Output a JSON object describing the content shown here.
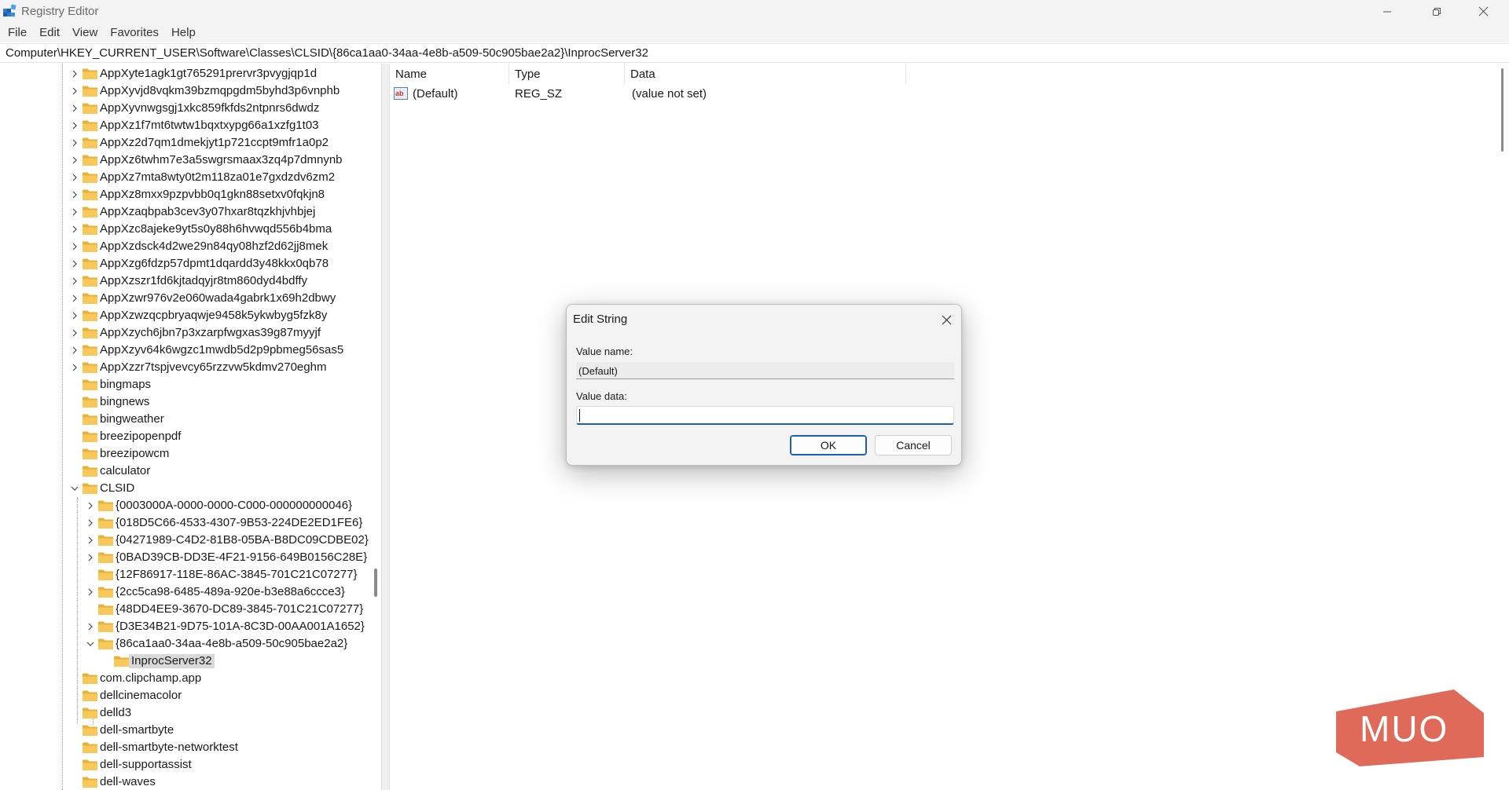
{
  "window": {
    "title": "Registry Editor",
    "colors": {
      "titlebar": "#f3f3f3",
      "accent": "#1a5fb4",
      "folder": "#f8c95a",
      "selection": "#d9d9d9"
    }
  },
  "menu": [
    "File",
    "Edit",
    "View",
    "Favorites",
    "Help"
  ],
  "address": "Computer\\HKEY_CURRENT_USER\\Software\\Classes\\CLSID\\{86ca1aa0-34aa-4e8b-a509-50c905bae2a2}\\InprocServer32",
  "tree": [
    {
      "label": "AppXyte1agk1gt765291prervr3pvygjqp1d",
      "level": 0,
      "chevron": "right"
    },
    {
      "label": "AppXyvjd8vqkm39bzmqpgdm5byhd3p6vnphb",
      "level": 0,
      "chevron": "right"
    },
    {
      "label": "AppXyvnwgsgj1xkc859fkfds2ntpnrs6dwdz",
      "level": 0,
      "chevron": "right"
    },
    {
      "label": "AppXz1f7mt6twtw1bqxtxypg66a1xzfg1t03",
      "level": 0,
      "chevron": "right"
    },
    {
      "label": "AppXz2d7qm1dmekjyt1p721ccpt9mfr1a0p2",
      "level": 0,
      "chevron": "right"
    },
    {
      "label": "AppXz6twhm7e3a5swgrsmaax3zq4p7dmnynb",
      "level": 0,
      "chevron": "right"
    },
    {
      "label": "AppXz7mta8wty0t2m118za01e7gxdzdv6zm2",
      "level": 0,
      "chevron": "right"
    },
    {
      "label": "AppXz8mxx9pzpvbb0q1gkn88setxv0fqkjn8",
      "level": 0,
      "chevron": "right"
    },
    {
      "label": "AppXzaqbpab3cev3y07hxar8tqzkhjvhbjej",
      "level": 0,
      "chevron": "right"
    },
    {
      "label": "AppXzc8ajeke9yt5s0y88h6hvwqd556b4bma",
      "level": 0,
      "chevron": "right"
    },
    {
      "label": "AppXzdsck4d2we29n84qy08hzf2d62jj8mek",
      "level": 0,
      "chevron": "right"
    },
    {
      "label": "AppXzg6fdzp57dpmt1dqardd3y48kkx0qb78",
      "level": 0,
      "chevron": "right"
    },
    {
      "label": "AppXzszr1fd6kjtadqyjr8tm860dyd4bdffy",
      "level": 0,
      "chevron": "right"
    },
    {
      "label": "AppXzwr976v2e060wada4gabrk1x69h2dbwy",
      "level": 0,
      "chevron": "right"
    },
    {
      "label": "AppXzwzqcpbryaqwje9458k5ykwbyg5fzk8y",
      "level": 0,
      "chevron": "right"
    },
    {
      "label": "AppXzych6jbn7p3xzarpfwgxas39g87myyjf",
      "level": 0,
      "chevron": "right"
    },
    {
      "label": "AppXzyv64k6wgzc1mwdb5d2p9pbmeg56sas5",
      "level": 0,
      "chevron": "right"
    },
    {
      "label": "AppXzzr7tspjvevcy65rzzvw5kdmv270eghm",
      "level": 0,
      "chevron": "right"
    },
    {
      "label": "bingmaps",
      "level": 0,
      "chevron": "none"
    },
    {
      "label": "bingnews",
      "level": 0,
      "chevron": "none"
    },
    {
      "label": "bingweather",
      "level": 0,
      "chevron": "none"
    },
    {
      "label": "breezipopenpdf",
      "level": 0,
      "chevron": "none"
    },
    {
      "label": "breezipowcm",
      "level": 0,
      "chevron": "none"
    },
    {
      "label": "calculator",
      "level": 0,
      "chevron": "none"
    },
    {
      "label": "CLSID",
      "level": 0,
      "chevron": "down"
    },
    {
      "label": "{0003000A-0000-0000-C000-000000000046}",
      "level": 1,
      "chevron": "right"
    },
    {
      "label": "{018D5C66-4533-4307-9B53-224DE2ED1FE6}",
      "level": 1,
      "chevron": "right"
    },
    {
      "label": "{04271989-C4D2-81B8-05BA-B8DC09CDBE02}",
      "level": 1,
      "chevron": "right"
    },
    {
      "label": "{0BAD39CB-DD3E-4F21-9156-649B0156C28E}",
      "level": 1,
      "chevron": "right"
    },
    {
      "label": "{12F86917-118E-86AC-3845-701C21C07277}",
      "level": 1,
      "chevron": "none"
    },
    {
      "label": "{2cc5ca98-6485-489a-920e-b3e88a6ccce3}",
      "level": 1,
      "chevron": "right"
    },
    {
      "label": "{48DD4EE9-3670-DC89-3845-701C21C07277}",
      "level": 1,
      "chevron": "none"
    },
    {
      "label": "{D3E34B21-9D75-101A-8C3D-00AA001A1652}",
      "level": 1,
      "chevron": "right"
    },
    {
      "label": "{86ca1aa0-34aa-4e8b-a509-50c905bae2a2}",
      "level": 1,
      "chevron": "down"
    },
    {
      "label": "InprocServer32",
      "level": 2,
      "chevron": "none",
      "selected": true
    },
    {
      "label": "com.clipchamp.app",
      "level": 0,
      "chevron": "none"
    },
    {
      "label": "dellcinemacolor",
      "level": 0,
      "chevron": "none"
    },
    {
      "label": "delld3",
      "level": 0,
      "chevron": "none"
    },
    {
      "label": "dell-smartbyte",
      "level": 0,
      "chevron": "none"
    },
    {
      "label": "dell-smartbyte-networktest",
      "level": 0,
      "chevron": "none"
    },
    {
      "label": "dell-supportassist",
      "level": 0,
      "chevron": "none"
    },
    {
      "label": "dell-waves",
      "level": 0,
      "chevron": "none"
    }
  ],
  "values": {
    "columns": [
      "Name",
      "Type",
      "Data"
    ],
    "rows": [
      {
        "icon": "string-value-icon",
        "name": "(Default)",
        "type": "REG_SZ",
        "data": "(value not set)"
      }
    ]
  },
  "dialog": {
    "title": "Edit String",
    "value_name_label": "Value name:",
    "value_name": "(Default)",
    "value_data_label": "Value data:",
    "value_data": "",
    "ok_label": "OK",
    "cancel_label": "Cancel"
  },
  "watermark": {
    "text": "MUO",
    "color": "#e06a5a"
  }
}
